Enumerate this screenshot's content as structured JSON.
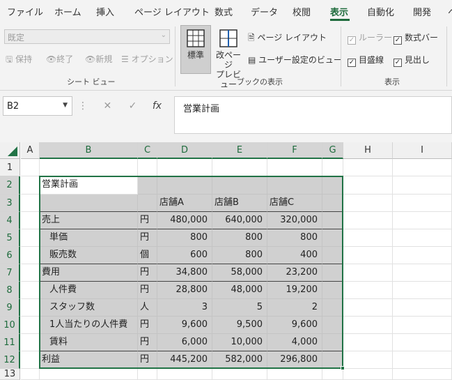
{
  "tabs": [
    "ファイル",
    "ホーム",
    "挿入",
    "ページ レイアウト",
    "数式",
    "データ",
    "校閲",
    "表示",
    "自動化",
    "開発",
    "ヘ"
  ],
  "active_tab": "表示",
  "ribbon": {
    "sheet_view": {
      "select_value": "既定",
      "keep": "保持",
      "exit": "終了",
      "new": "新規",
      "options": "オプション",
      "group_label": "シート ビュー"
    },
    "workbook_views": {
      "normal": "標準",
      "page_break_line1": "改ページ",
      "page_break_line2": "プレビュー",
      "page_layout": "ページ レイアウト",
      "custom_views": "ユーザー設定のビュー",
      "group_label": "ブックの表示"
    },
    "show": {
      "ruler": "ルーラー",
      "formula_bar": "数式バー",
      "gridlines": "目盛線",
      "headings": "見出し",
      "group_label": "表示"
    }
  },
  "formula_bar": {
    "name_box": "B2",
    "content": "営業計画",
    "fx": "fx"
  },
  "columns": [
    "A",
    "B",
    "C",
    "D",
    "E",
    "F",
    "G",
    "H",
    "I"
  ],
  "rows": [
    "1",
    "2",
    "3",
    "4",
    "5",
    "6",
    "7",
    "8",
    "9",
    "10",
    "11",
    "12",
    "13"
  ],
  "sheet": {
    "title": "営業計画",
    "headers": [
      "店舗A",
      "店舗B",
      "店舗C"
    ],
    "data": [
      {
        "label": "売上",
        "unit": "円",
        "values": [
          "480,000",
          "640,000",
          "320,000"
        ]
      },
      {
        "label": "単価",
        "unit": "円",
        "values": [
          "800",
          "800",
          "800"
        ]
      },
      {
        "label": "販売数",
        "unit": "個",
        "values": [
          "600",
          "800",
          "400"
        ]
      },
      {
        "label": "費用",
        "unit": "円",
        "values": [
          "34,800",
          "58,000",
          "23,200"
        ]
      },
      {
        "label": "人件費",
        "unit": "円",
        "values": [
          "28,800",
          "48,000",
          "19,200"
        ]
      },
      {
        "label": "スタッフ数",
        "unit": "人",
        "values": [
          "3",
          "5",
          "2"
        ]
      },
      {
        "label": "1人当たりの人件費",
        "unit": "円",
        "values": [
          "9,600",
          "9,500",
          "9,600"
        ]
      },
      {
        "label": "賃料",
        "unit": "円",
        "values": [
          "6,000",
          "10,000",
          "4,000"
        ]
      },
      {
        "label": "利益",
        "unit": "円",
        "values": [
          "445,200",
          "582,000",
          "296,800"
        ]
      }
    ]
  },
  "colors": {
    "accent": "#217346",
    "selection_fill": "#d0d0d0"
  }
}
